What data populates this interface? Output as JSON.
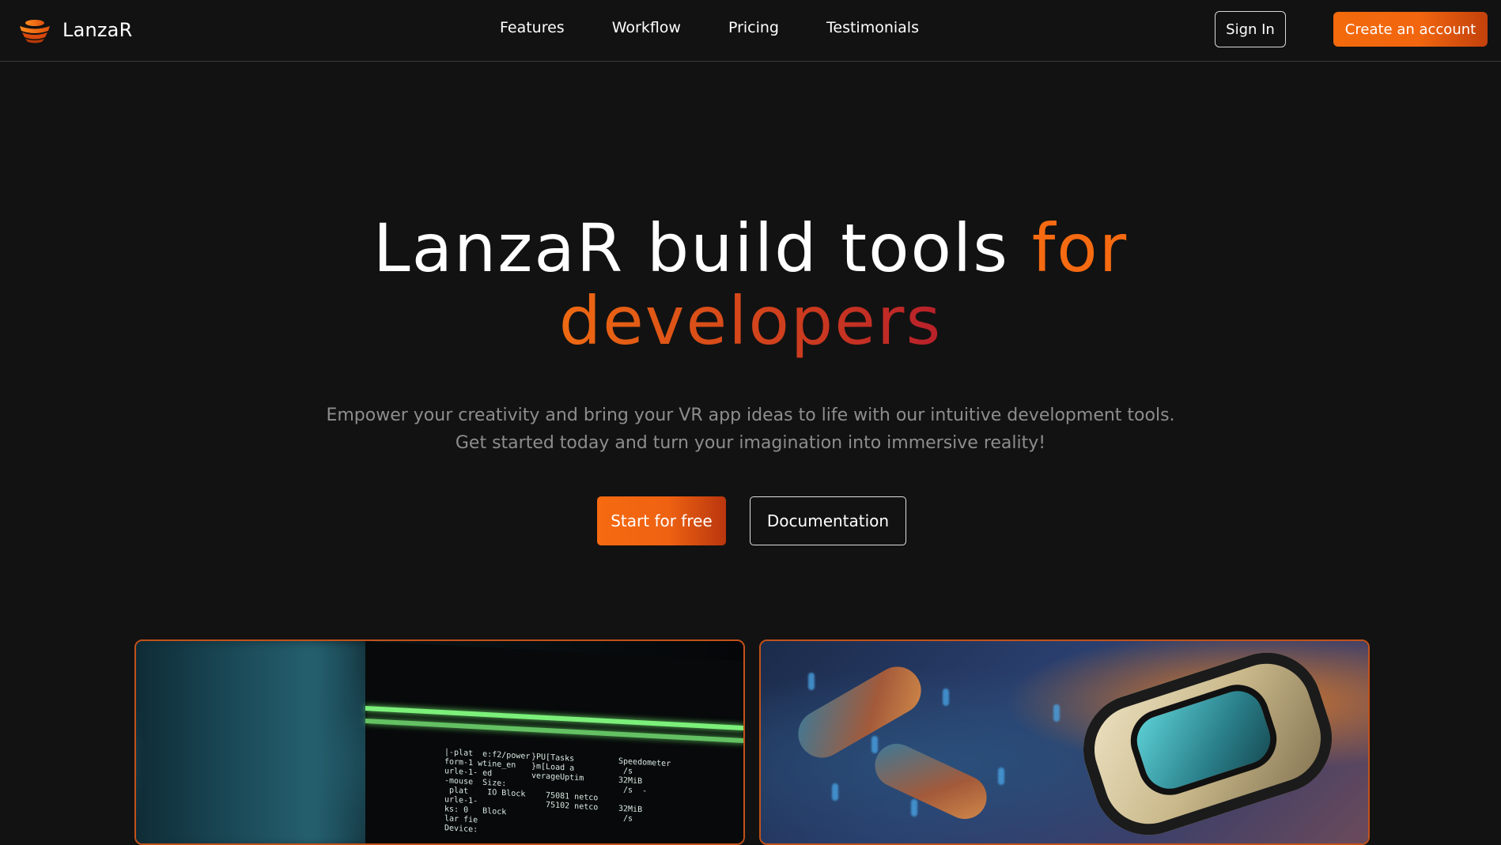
{
  "brand": {
    "name": "LanzaR",
    "logo_icon": "layered-disc-logo-icon"
  },
  "nav": {
    "links": [
      "Features",
      "Workflow",
      "Pricing",
      "Testimonials"
    ],
    "sign_in": "Sign In",
    "create_account": "Create an account"
  },
  "hero": {
    "title_part1": "LanzaR build tools ",
    "title_accent1": "for",
    "title_accent2": "developers",
    "subtitle_line1": "Empower your creativity and bring your VR app ideas to life with our intuitive development tools.",
    "subtitle_line2": "Get started today and turn your imagination into immersive reality!",
    "cta_primary": "Start for free",
    "cta_secondary": "Documentation"
  },
  "colors": {
    "background": "#121212",
    "accent_orange": "#f66a11",
    "accent_red": "#b8202a",
    "muted_text": "#8d8d8d",
    "card_border": "#c2521a"
  },
  "cards": [
    {
      "image": "terminal-screen-photo"
    },
    {
      "image": "vr-headset-photo"
    }
  ]
}
